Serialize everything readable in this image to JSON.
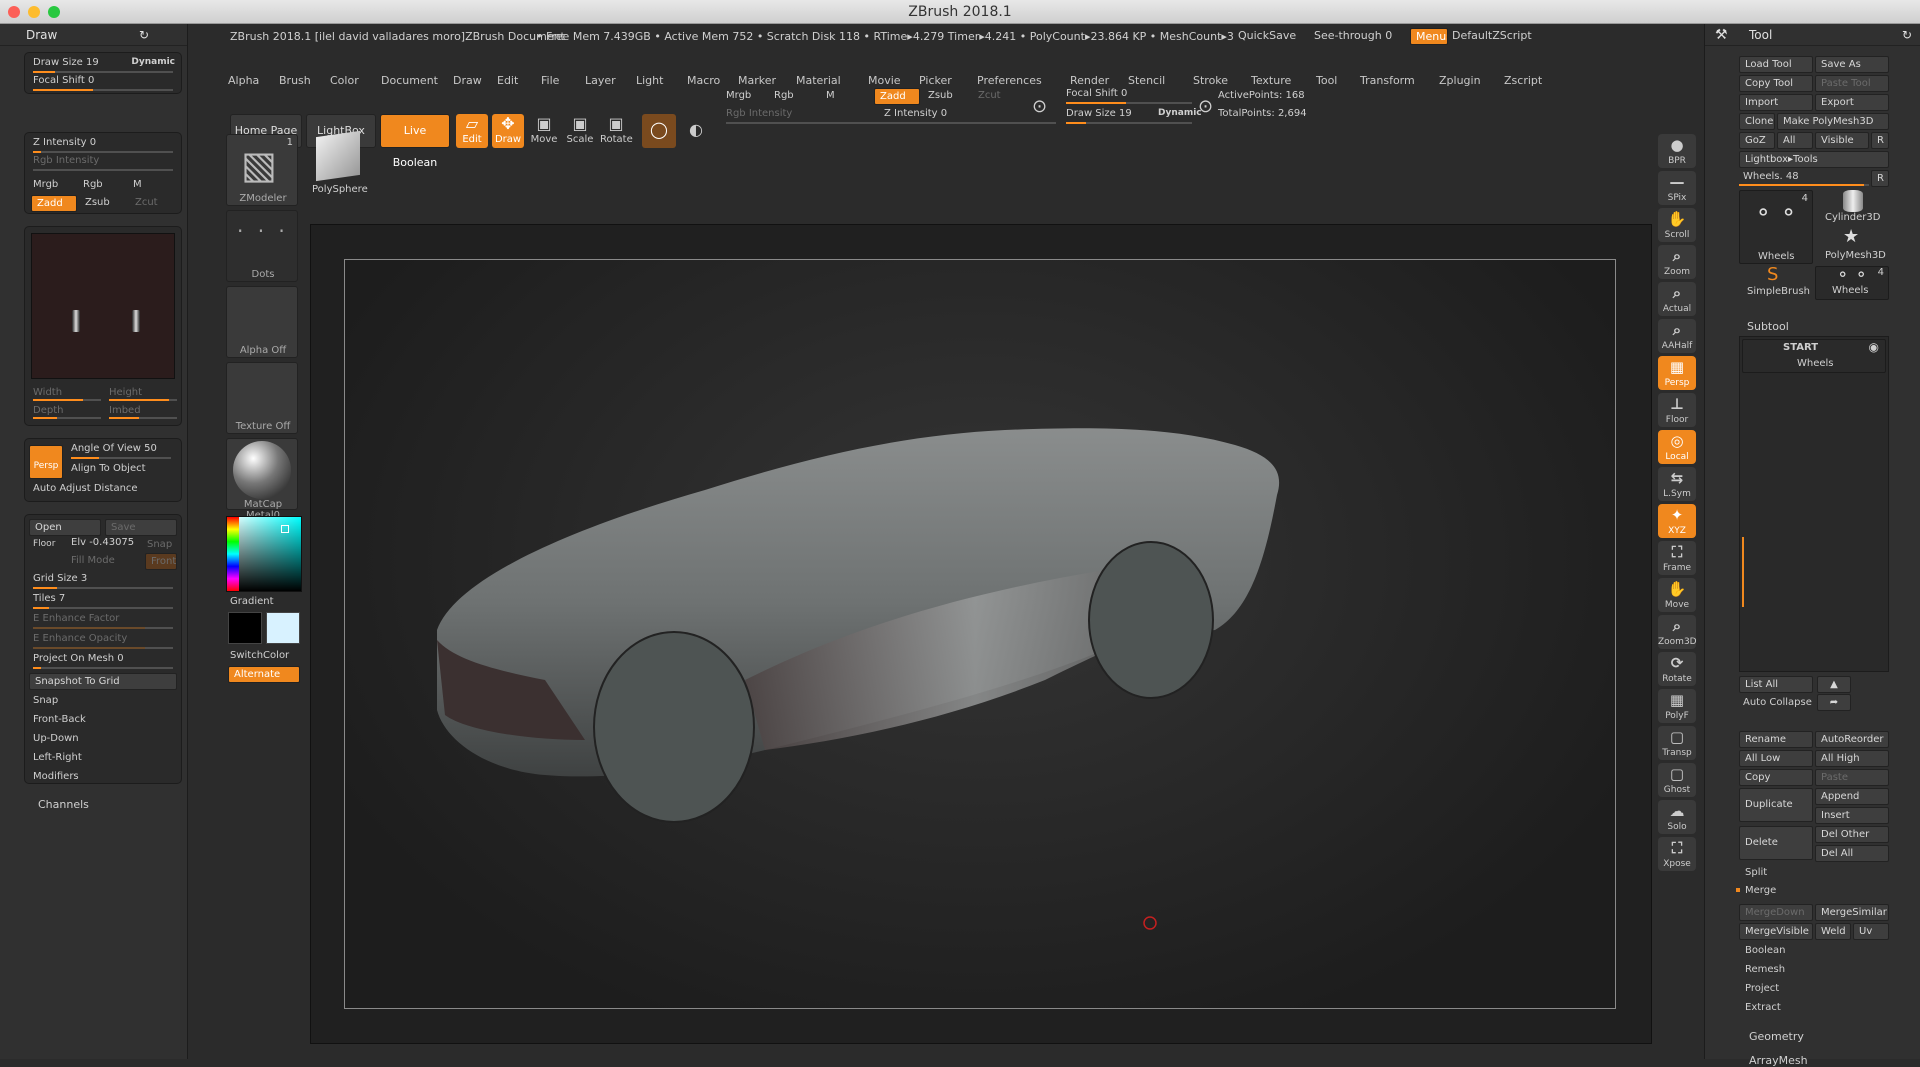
{
  "app": {
    "title": "ZBrush 2018.1"
  },
  "titlebar": {
    "document": "ZBrush 2018.1 [ilel david valladares moro]ZBrush Document",
    "stats": "• Free Mem 7.439GB • Active Mem 752 • Scratch Disk 118 • RTime▸4.279 Timer▸4.241 • PolyCount▸23.864 KP • MeshCount▸3",
    "quicksave": "QuickSave",
    "seethrough": "See-through 0",
    "menus": "Menus",
    "script": "DefaultZScript"
  },
  "menu": [
    "Alpha",
    "Brush",
    "Color",
    "Document",
    "Draw",
    "Edit",
    "File",
    "Layer",
    "Light",
    "Macro",
    "Marker",
    "Material",
    "Movie",
    "Picker",
    "Preferences",
    "Render",
    "Stencil",
    "Stroke",
    "Texture",
    "Tool",
    "Transform",
    "Zplugin",
    "Zscript"
  ],
  "toolbar": {
    "home": "Home Page",
    "lightbox": "LightBox",
    "liveboolean": "Live Boolean",
    "edit": "Edit",
    "draw": "Draw",
    "move": "Move",
    "scale": "Scale",
    "rotate": "Rotate",
    "mrgb": "Mrgb",
    "rgb": "Rgb",
    "m": "M",
    "rgb_intensity": "Rgb Intensity",
    "zadd": "Zadd",
    "zsub": "Zsub",
    "zcut": "Zcut",
    "z_intensity": "Z Intensity 0",
    "focal_shift": "Focal Shift 0",
    "draw_size": "Draw Size 19",
    "dynamic": "Dynamic",
    "active_points": "ActivePoints: 168",
    "total_points": "TotalPoints: 2,694",
    "z_intensity_value": 0,
    "focal_shift_value": 0,
    "draw_size_value": 19
  },
  "left_panel": {
    "title": "Draw",
    "draw_size": "Draw Size 19",
    "dynamic": "Dynamic",
    "focal_shift": "Focal Shift 0",
    "z_intensity": "Z Intensity 0",
    "rgb_intensity": "Rgb Intensity",
    "mrgb": "Mrgb",
    "rgb": "Rgb",
    "m": "M",
    "zadd": "Zadd",
    "zsub": "Zsub",
    "zcut": "Zcut",
    "width": "Width",
    "height": "Height",
    "depth": "Depth",
    "imbed": "Imbed",
    "persp": "Persp",
    "angle_of_view": "Angle Of View 50",
    "align_to_object": "Align To Object",
    "auto_adjust": "Auto Adjust Distance",
    "open": "Open",
    "save": "Save",
    "floor": "Floor",
    "elv": "Elv -0.43075",
    "snap": "Snap",
    "fill_mode": "Fill Mode",
    "front": "Front",
    "grid_size": "Grid Size 3",
    "tiles": "Tiles 7",
    "enhance_factor": "E Enhance Factor",
    "enhance_opacity": "E Enhance Opacity",
    "project_on_mesh": "Project On Mesh 0",
    "snapshot": "Snapshot To Grid",
    "items": [
      "Snap",
      "Front-Back",
      "Up-Down",
      "Left-Right",
      "Modifiers"
    ],
    "channels": "Channels",
    "angle_of_view_value": 50
  },
  "shelf_left": {
    "zmodeler": "ZModeler",
    "zmodeler_count": "1",
    "polysphere": "PolySphere",
    "dots": "Dots",
    "alpha_off": "Alpha Off",
    "texture_off": "Texture Off",
    "matcap": "MatCap Metal0",
    "gradient": "Gradient",
    "switchcolor": "SwitchColor",
    "alternate": "Alternate"
  },
  "shelf_right": {
    "items": [
      "BPR",
      "SPix",
      "Scroll",
      "Zoom",
      "Actual",
      "AAHalf",
      "Persp",
      "Floor",
      "Local",
      "L.Sym",
      "XYZ",
      "Frame",
      "Move",
      "Zoom3D",
      "Rotate",
      "PolyF",
      "Transp",
      "Ghost",
      "Solo",
      "Xpose"
    ]
  },
  "right_panel": {
    "title": "Tool",
    "load_tool": "Load Tool",
    "save_as": "Save As",
    "copy_tool": "Copy Tool",
    "paste_tool": "Paste Tool",
    "import": "Import",
    "export": "Export",
    "clone": "Clone",
    "make_polymesh": "Make PolyMesh3D",
    "goz": "GoZ",
    "all": "All",
    "visible": "Visible",
    "r": "R",
    "lightbox_tools": "Lightbox▸Tools",
    "wheels_slider": "Wheels. 48",
    "tools": [
      {
        "name": "Wheels",
        "count": "4"
      },
      {
        "name": "Cylinder3D",
        "count": ""
      },
      {
        "name": "PolyMesh3D",
        "count": ""
      },
      {
        "name": "SimpleBrush",
        "count": ""
      },
      {
        "name": "Wheels",
        "count": "4"
      }
    ],
    "subtool": "Subtool",
    "subtool_item": "Wheels",
    "start": "START",
    "list_all": "List All",
    "auto_collapse": "Auto Collapse",
    "rename": "Rename",
    "autoreorder": "AutoReorder",
    "all_low": "All Low",
    "all_high": "All High",
    "copy": "Copy",
    "paste": "Paste",
    "duplicate": "Duplicate",
    "append": "Append",
    "insert": "Insert",
    "delete": "Delete",
    "del_other": "Del Other",
    "del_all": "Del All",
    "split": "Split",
    "merge": "Merge",
    "mergedown": "MergeDown",
    "mergesimilar": "MergeSimilar",
    "mergevisible": "MergeVisible",
    "weld": "Weld",
    "uv": "Uv",
    "boolean": "Boolean",
    "remesh": "Remesh",
    "project": "Project",
    "extract": "Extract",
    "geometry": "Geometry",
    "arraymesh": "ArrayMesh",
    "wheels_value": 48
  },
  "colors": {
    "accent": "#f0881e",
    "panel": "#303030",
    "canvas": "#1d1d1d"
  }
}
